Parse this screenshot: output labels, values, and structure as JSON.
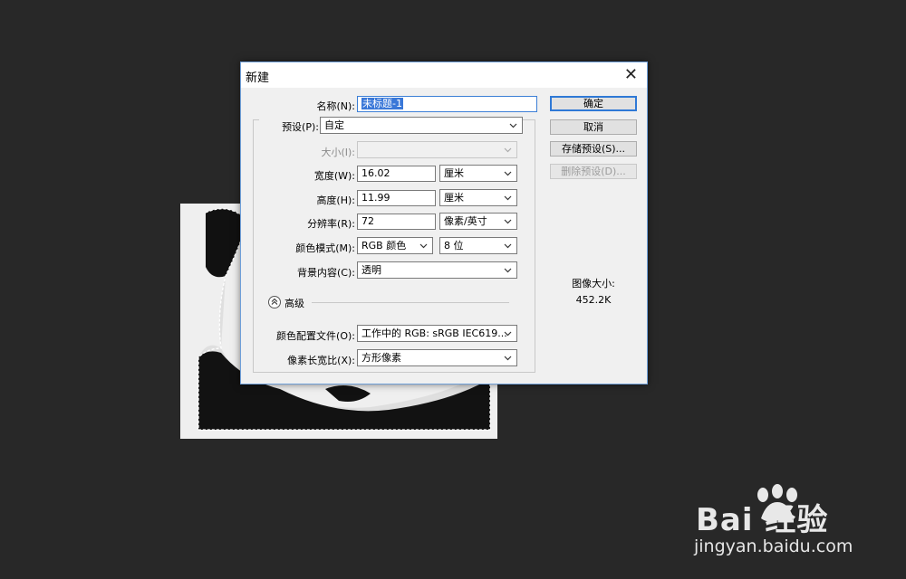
{
  "dialog": {
    "title": "新建",
    "close_glyph": "✕",
    "name_label": "名称(N):",
    "name_value": "未标题-1",
    "preset_label": "预设(P):",
    "preset_value": "自定",
    "size_label": "大小(I):",
    "size_value": "",
    "width_label": "宽度(W):",
    "width_value": "16.02",
    "width_unit": "厘米",
    "height_label": "高度(H):",
    "height_value": "11.99",
    "height_unit": "厘米",
    "resolution_label": "分辨率(R):",
    "resolution_value": "72",
    "resolution_unit": "像素/英寸",
    "color_mode_label": "颜色模式(M):",
    "color_mode_value": "RGB 颜色",
    "bit_depth_value": "8 位",
    "background_label": "背景内容(C):",
    "background_value": "透明",
    "advanced_label": "高级",
    "color_profile_label": "颜色配置文件(O):",
    "color_profile_value": "工作中的 RGB: sRGB IEC619...",
    "pixel_aspect_label": "像素长宽比(X):",
    "pixel_aspect_value": "方形像素",
    "buttons": {
      "ok": "确定",
      "cancel": "取消",
      "save_preset": "存储预设(S)...",
      "delete_preset": "删除预设(D)..."
    },
    "image_size_label": "图像大小:",
    "image_size_value": "452.2K"
  },
  "watermark": {
    "brand": "Bai 经验",
    "url": "jingyan.baidu.com"
  },
  "icons": [
    "close-icon",
    "chevron-down-icon",
    "advanced-toggle-icon",
    "baidu-paw-icon"
  ]
}
